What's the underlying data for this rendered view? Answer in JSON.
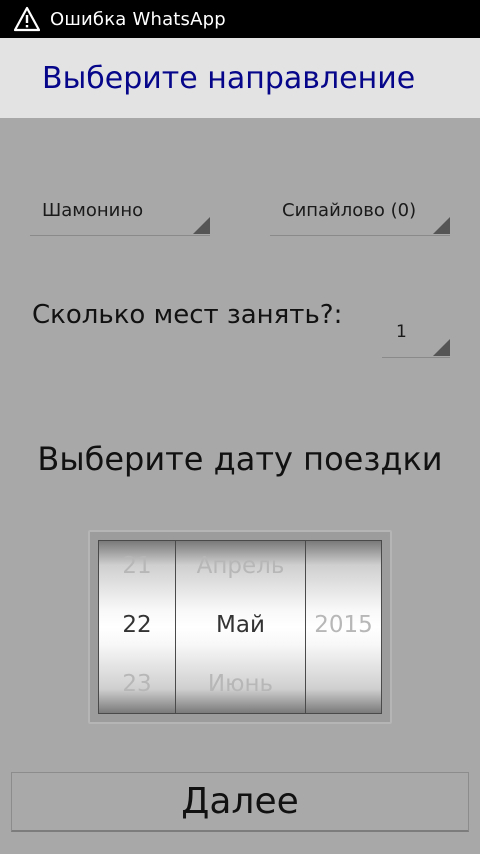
{
  "status_bar": {
    "icon": "warning-triangle-icon",
    "text": "Ошибка WhatsApp"
  },
  "title": "Выберите направление",
  "route": {
    "from": "Шамонино",
    "to": "Сипайлово (0)"
  },
  "seats": {
    "label": "Сколько мест занять?:",
    "value": "1"
  },
  "date": {
    "heading": "Выберите дату поездки",
    "day": {
      "prev": "21",
      "selected": "22",
      "next": "23"
    },
    "month": {
      "prev": "Апрель",
      "selected": "Май",
      "next": "Июнь"
    },
    "year": {
      "selected": "2015"
    }
  },
  "next_button": "Далее",
  "colors": {
    "title_text": "#06068a",
    "background": "#a8a8a8",
    "title_bar": "#e3e3e3"
  }
}
